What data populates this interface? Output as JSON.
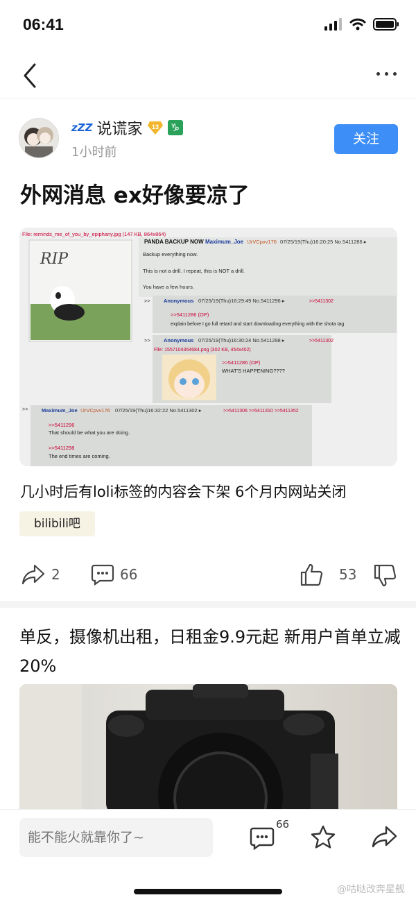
{
  "status": {
    "time": "06:41"
  },
  "user": {
    "zzz": "zZZ",
    "name": "说谎家",
    "level": "13",
    "sign": "♑",
    "time": "1小时前"
  },
  "follow_label": "关注",
  "post": {
    "title": "外网消息 ex好像要凉了",
    "description": "几小时后有loli标签的内容会下架 6个月内网站关闭",
    "tag": "bilibili吧"
  },
  "forum": {
    "file": "File: reminds_me_of_you_by_epiphany.jpg (147 KB, 864x864)",
    "op_subject": "PANDA BACKUP NOW",
    "op_name": "Maximum_Joe",
    "op_trip": "!JrVCpvv176",
    "op_meta": "07/25/19(Thu)16:20:25 No.5411286 ▸",
    "op_lines": [
      "Backup everything now.",
      "This is not a drill. I repeat, this is NOT a drill.",
      "You have a few hours."
    ],
    "reply1": {
      "name": "Anonymous",
      "meta": "07/25/19(Thu)16:29:49 No.5411296 ▸",
      "backlink": ">>5411302",
      "quote": ">>5411286 (OP)",
      "text": "explain before I go full retard and start downloading everything with the shota tag"
    },
    "reply2": {
      "name": "Anonymous",
      "meta": "07/25/19(Thu)16:30:24 No.5411298 ▸",
      "backlink": ">>5411302",
      "file": "File: 1557104364684.png (302 KB, 454x402)",
      "quote": ">>5411286 (OP)",
      "text": "WHAT'S HAPPENING????"
    },
    "reply3": {
      "name": "Maximum_Joe",
      "trip": "!JrVCpvv176",
      "meta": "07/25/19(Thu)16:32:22 No.5411302 ▸",
      "backlinks": ">>5411306 >>5411310 >>5411352",
      "q1": ">>5411296",
      "t1": "That should be what you are doing.",
      "q2": ">>5411298",
      "t2": "The end times are coming."
    },
    "rip": "RIP"
  },
  "actions": {
    "share_count": "2",
    "comment_count": "66",
    "like_count": "53"
  },
  "ad": {
    "title": "单反，摄像机出租，日租金9.9元起 新用户首单立减20%"
  },
  "bottom": {
    "placeholder": "能不能火就靠你了~",
    "comment_badge": "66",
    "watermark": "@咕哒改奔星舰"
  },
  "icons": [
    "back-icon",
    "more-icon",
    "share-icon",
    "comment-icon",
    "thumbs-up-icon",
    "thumbs-down-icon",
    "star-icon"
  ]
}
